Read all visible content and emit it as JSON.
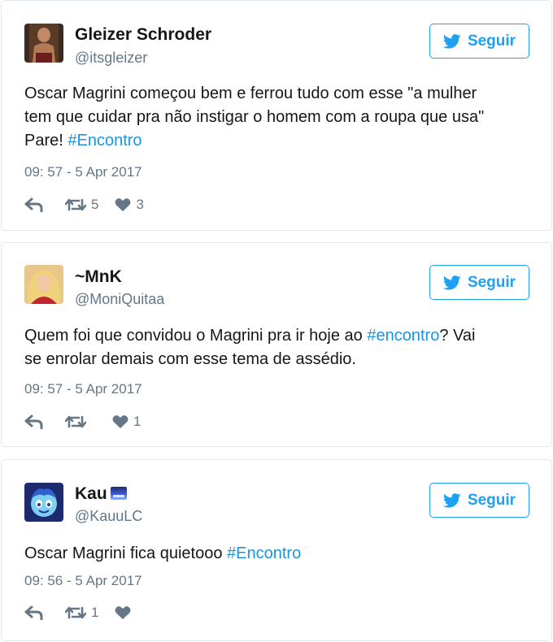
{
  "follow_label": "Seguir",
  "colors": {
    "accent": "#1da1f2",
    "hashtag": "#1b95e0",
    "muted": "#657786",
    "border": "#e1e8ed"
  },
  "tweets": [
    {
      "name": "Gleizer Schroder",
      "handle": "@itsgleizer",
      "text_lines": [
        "Oscar Magrini começou bem e ferrou tudo com esse \"a mulher",
        "tem que cuidar pra não instigar o homem com a roupa que usa\""
      ],
      "text_tail": "Pare! ",
      "hashtag": "#Encontro",
      "time": "09: 57 - 5 Apr 2017",
      "retweets": "5",
      "likes": "3"
    },
    {
      "name": "~MnK",
      "handle": "@MoniQuitaa",
      "text_pre": "Quem foi que convidou o Magrini pra ir hoje ao ",
      "hashtag": "#encontro",
      "text_post": "? Vai",
      "text_line2": "se enrolar demais com esse tema de assédio.",
      "time": "09: 57 - 5 Apr 2017",
      "likes": "1"
    },
    {
      "name": "Kau",
      "handle": "@KauuLC",
      "text_pre": "Oscar Magrini fica quietooo ",
      "hashtag": "#Encontro",
      "time": "09: 56 - 5 Apr 2017",
      "retweets": "1"
    }
  ]
}
